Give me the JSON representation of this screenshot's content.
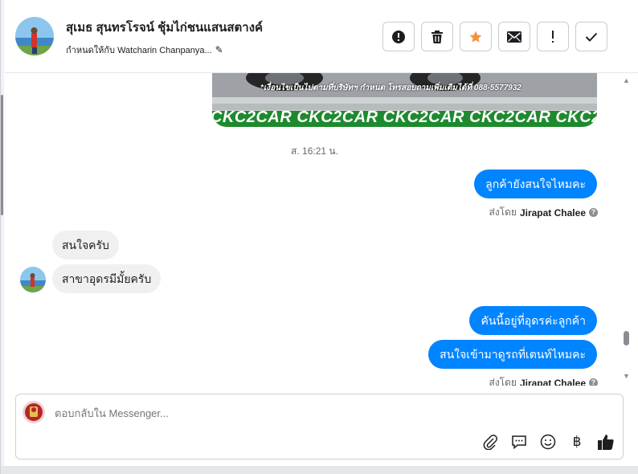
{
  "header": {
    "contact_name": "สุเมธ สุนทรโรจน์ ชุ้มไก่ชนแสนสตางค์",
    "assigned_label": "กำหนดให้กับ Watcharin Chanpanya...",
    "actions": [
      {
        "name": "mark-spam-button",
        "icon": "alert-circle-icon"
      },
      {
        "name": "delete-button",
        "icon": "trash-icon"
      },
      {
        "name": "star-button",
        "icon": "star-icon"
      },
      {
        "name": "mark-unread-button",
        "icon": "envelope-icon"
      },
      {
        "name": "follow-up-button",
        "icon": "exclamation-icon"
      },
      {
        "name": "mark-done-button",
        "icon": "check-icon"
      }
    ],
    "accent_star": "#f7923a"
  },
  "conversation": {
    "image_caption_line1": "*เงื่อนไขเป็นไปตามที่บริษัทฯ กำหนด โทรสอบถามเพิ่มเติมได้ที่ 088-5577932",
    "image_banner_text": "CKC2CAR CKC2CAR CKC2CAR CKC2CAR CKC2",
    "timestamp": "ส. 16:21 น.",
    "messages": [
      {
        "side": "out",
        "text": "ลูกค้ายังสนใจไหมคะ"
      },
      {
        "side": "in",
        "text": "สนใจครับ"
      },
      {
        "side": "in",
        "text": "สาขาอุดรมีมั้ยครับ"
      },
      {
        "side": "out",
        "text": "คันนี้อยู่ที่อุดรค่ะลูกค้า"
      },
      {
        "side": "out",
        "text": "สนใจเข้ามาดูรถที่เตนท์ไหมคะ"
      }
    ],
    "sent_by_prefix": "ส่งโดย",
    "sent_by_name": "Jirapat Chalee"
  },
  "composer": {
    "placeholder": "ตอบกลับใน Messenger...",
    "tools": [
      "paperclip-icon",
      "saved-reply-icon",
      "emoji-icon",
      "baht-icon",
      "thumbs-up-icon"
    ]
  },
  "colors": {
    "messenger_blue": "#0084ff",
    "incoming_bubble": "#f0f0f0",
    "banner_green": "#1e8a2e"
  }
}
